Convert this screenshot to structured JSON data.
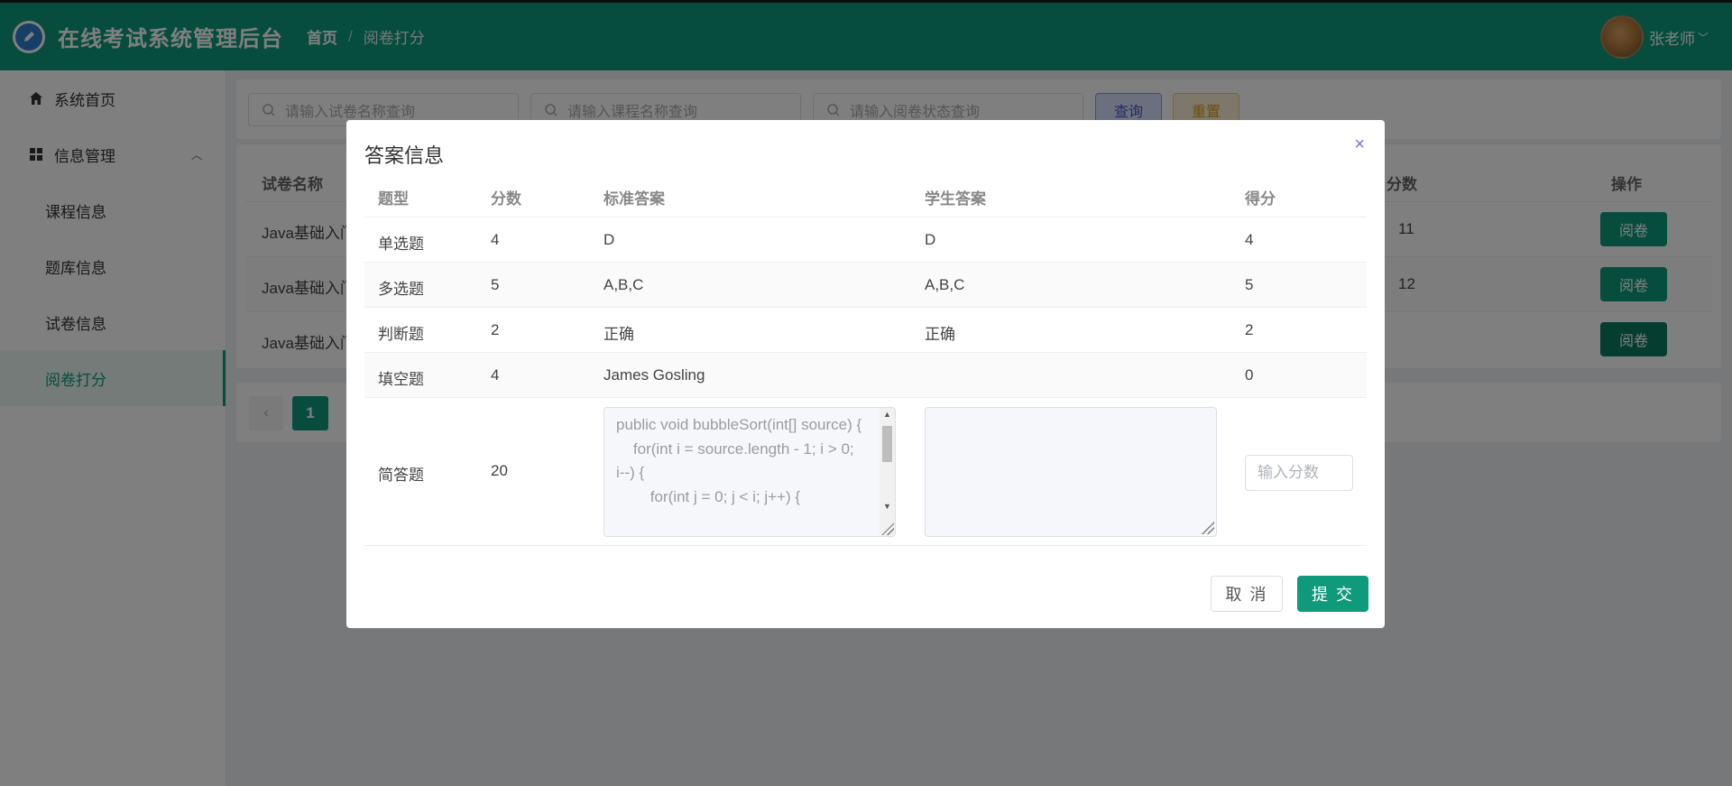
{
  "app": {
    "title": "在线考试系统管理后台"
  },
  "breadcrumb": {
    "home": "首页",
    "separator": "/",
    "current": "阅卷打分"
  },
  "user": {
    "name": "张老师"
  },
  "sidebar": {
    "items": [
      {
        "label": "系统首页",
        "icon": "home-icon"
      },
      {
        "label": "信息管理",
        "icon": "grid-icon"
      },
      {
        "label": "课程信息"
      },
      {
        "label": "题库信息"
      },
      {
        "label": "试卷信息"
      },
      {
        "label": "阅卷打分",
        "active": true
      }
    ]
  },
  "search": {
    "paper_placeholder": "请输入试卷名称查询",
    "course_placeholder": "请输入课程名称查询",
    "status_placeholder": "请输入阅卷状态查询",
    "query_label": "查询",
    "reset_label": "重置"
  },
  "background_table": {
    "headers": {
      "paper_name": "试卷名称",
      "score": "分数",
      "action": "操作"
    },
    "rows": [
      {
        "paper_name": "Java基础入门",
        "score": "11",
        "action": "阅卷"
      },
      {
        "paper_name": "Java基础入门",
        "score": "12",
        "action": "阅卷"
      },
      {
        "paper_name": "Java基础入门",
        "score": "",
        "action": "阅卷"
      }
    ]
  },
  "pagination": {
    "prev": "‹",
    "current_page": "1"
  },
  "dialog": {
    "title": "答案信息",
    "close": "×",
    "headers": {
      "type": "题型",
      "points": "分数",
      "standard": "标准答案",
      "student": "学生答案",
      "score": "得分"
    },
    "rows": [
      {
        "type": "单选题",
        "points": "4",
        "standard": "D",
        "student": "D",
        "score": "4"
      },
      {
        "type": "多选题",
        "points": "5",
        "standard": "A,B,C",
        "student": "A,B,C",
        "score": "5"
      },
      {
        "type": "判断题",
        "points": "2",
        "standard": "正确",
        "student": "正确",
        "score": "2"
      },
      {
        "type": "填空题",
        "points": "4",
        "standard": "James Gosling",
        "student": "",
        "score": "0"
      }
    ],
    "essay": {
      "type": "简答题",
      "points": "20",
      "standard_answer": "public void bubbleSort(int[] source) {\n    for(int i = source.length - 1; i > 0; i--) {\n        for(int j = 0; j < i; j++) {",
      "student_answer": "",
      "score_placeholder": "输入分数"
    },
    "cancel_label": "取 消",
    "submit_label": "提 交"
  },
  "colors": {
    "primary": "#0f9a7c",
    "overlay": "rgba(0,0,0,0.5)"
  }
}
